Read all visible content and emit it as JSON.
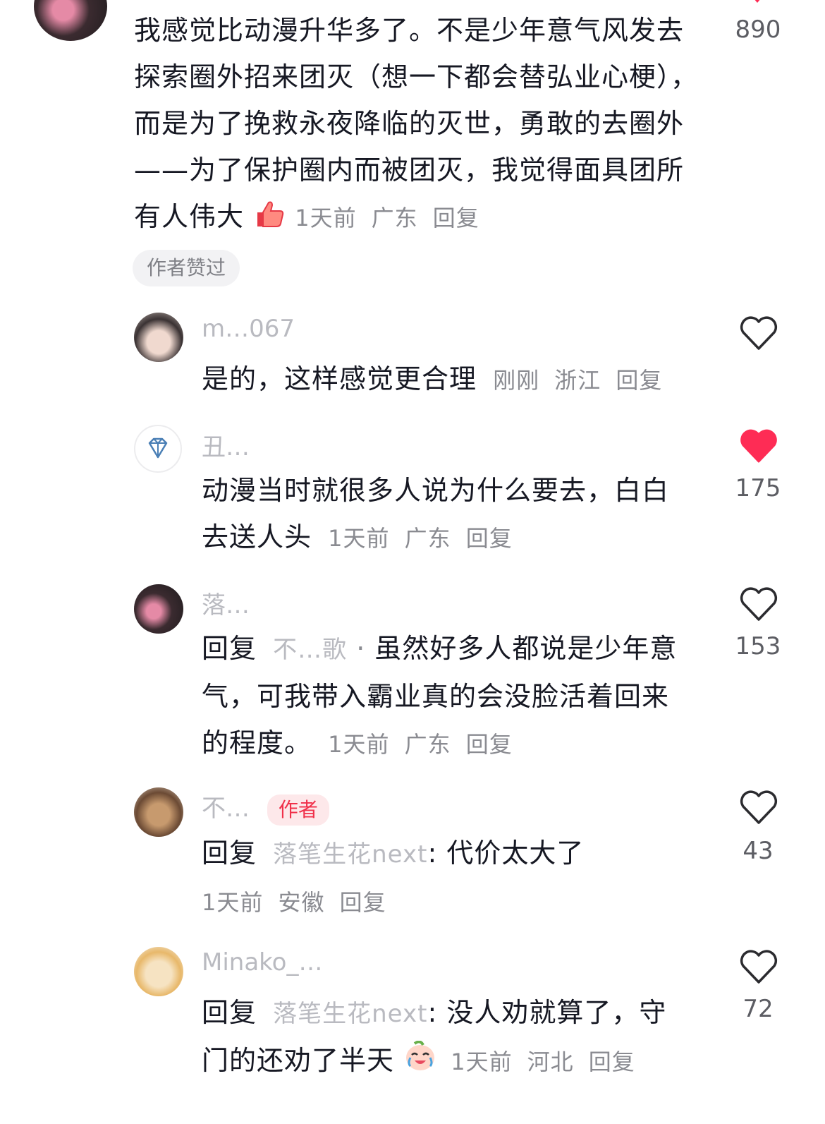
{
  "top_comment": {
    "text": "我感觉比动漫升华多了。不是少年意气风发去探索圈外招来团灭（想一下都会替弘业心梗），而是为了挽救永夜降临的灭世，勇敢的去圈外——为了保护圈内而被团灭，我觉得面具团所有人伟大",
    "emoji": "thumbs-up-emoji",
    "time": "1天前",
    "location": "广东",
    "reply_label": "回复",
    "like_count": "890",
    "badge": "作者赞过"
  },
  "replies": [
    {
      "username": "m…067",
      "text": "是的，这样感觉更合理",
      "time": "刚刚",
      "location": "浙江",
      "reply_label": "回复",
      "like_count": "",
      "liked": false
    },
    {
      "username": "丑…",
      "text": "动漫当时就很多人说为什么要去，白白去送人头",
      "time": "1天前",
      "location": "广东",
      "reply_label": "回复",
      "like_count": "175",
      "liked": true
    },
    {
      "username": "落…",
      "reply_prefix": "回复",
      "reply_to": "不…歌",
      "text": "虽然好多人都说是少年意气，可我带入霸业真的会没脸活着回来的程度。",
      "time": "1天前",
      "location": "广东",
      "reply_label": "回复",
      "like_count": "153",
      "liked": false
    },
    {
      "username": "不…",
      "author_badge": "作者",
      "reply_prefix": "回复",
      "reply_to": "落笔生花next",
      "text": "代价太大了",
      "time": "1天前",
      "location": "安徽",
      "reply_label": "回复",
      "like_count": "43",
      "liked": false
    },
    {
      "username": "Minako_…",
      "reply_prefix": "回复",
      "reply_to": "落笔生花next",
      "text": "没人劝就算了，守门的还劝了半天",
      "emoji": "crying-laughing-emoji",
      "time": "1天前",
      "location": "河北",
      "reply_label": "回复",
      "like_count": "72",
      "liked": false
    }
  ],
  "colors": {
    "text": "#161823",
    "meta": "#8a8b91",
    "liked": "#fe2c55",
    "author_tag_bg": "#fde8ea",
    "author_tag_text": "#f0304a"
  }
}
